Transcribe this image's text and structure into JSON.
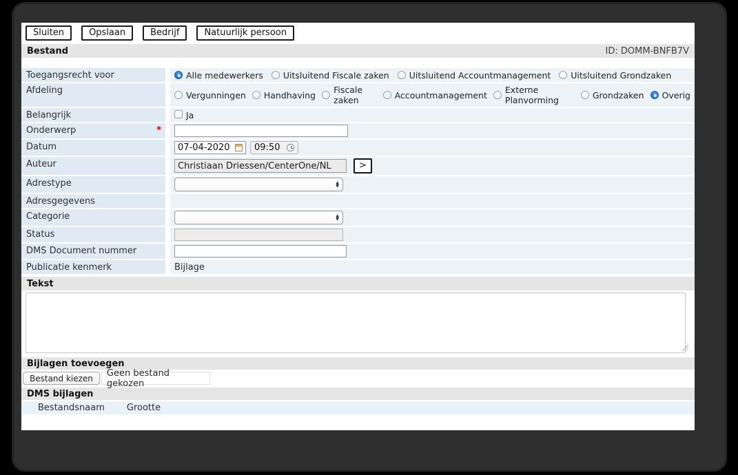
{
  "window": {
    "id": "ID: DOMM-BNFB7V"
  },
  "toolbar": {
    "buttons": [
      "Sluiten",
      "Opslaan",
      "Bedrijf",
      "Natuurlijk persoon"
    ]
  },
  "sections": {
    "bestand": "Bestand",
    "tekst": "Tekst",
    "bijlagen_toevoegen": "Bijlagen toevoegen",
    "dms_bijlagen": "DMS bijlagen"
  },
  "form": {
    "toegangsrecht": {
      "label": "Toegangsrecht voor",
      "selected": "Alle medewerkers",
      "options": [
        "Alle medewerkers",
        "Uitsluitend Fiscale zaken",
        "Uitsluitend Accountmanagement",
        "Uitsluitend Grondzaken"
      ]
    },
    "afdeling": {
      "label": "Afdeling",
      "selected": "Overig",
      "options": [
        "Vergunningen",
        "Handhaving",
        "Fiscale zaken",
        "Accountmanagement",
        "Externe Planvorming",
        "Grondzaken",
        "Overig"
      ]
    },
    "belangrijk": {
      "label": "Belangrijk",
      "checkbox_label": "Ja",
      "checked": false
    },
    "onderwerp": {
      "label": "Onderwerp",
      "required_marker": "*",
      "value": ""
    },
    "datum": {
      "label": "Datum",
      "date": "07-04-2020",
      "time": "09:50"
    },
    "auteur": {
      "label": "Auteur",
      "value": "Christiaan Driessen/CenterOne/NL",
      "button": ">"
    },
    "adrestype": {
      "label": "Adrestype",
      "value": ""
    },
    "adresgegevens": {
      "label": "Adresgegevens",
      "value": ""
    },
    "categorie": {
      "label": "Categorie",
      "value": ""
    },
    "status": {
      "label": "Status",
      "value": ""
    },
    "dms_document_nummer": {
      "label": "DMS Document nummer",
      "value": ""
    },
    "publicatie_kenmerk": {
      "label": "Publicatie kenmerk",
      "value": "Bijlage"
    }
  },
  "tekst": {
    "value": ""
  },
  "bijlagen": {
    "choose_button": "Bestand kiezen",
    "no_file": "Geen bestand gekozen"
  },
  "dms_tabel": {
    "columns": [
      "Bestandsnaam",
      "Grootte"
    ],
    "rows": []
  },
  "colors": {
    "accent": "#2176e0",
    "label_bg": "#dfeaf4",
    "row_bg": "#edf2f7",
    "bar_bg": "#e5e5e5",
    "required": "#d90000"
  }
}
